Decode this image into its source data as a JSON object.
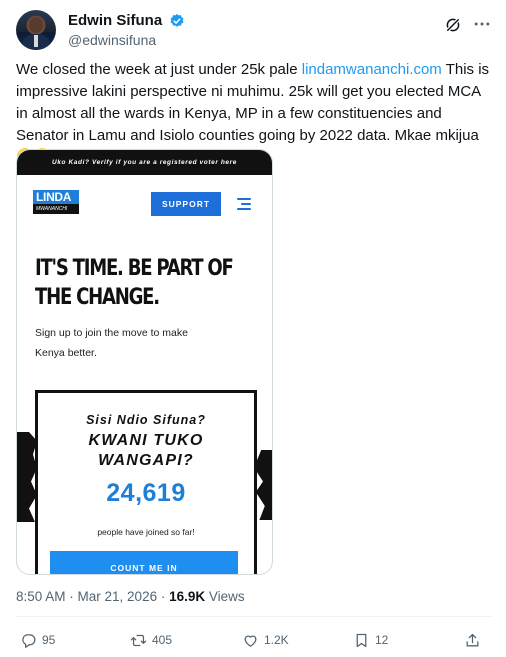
{
  "author": {
    "display_name": "Edwin Sifuna",
    "handle": "@edwinsifuna"
  },
  "tweet": {
    "text_before_link": "We closed the week at just under 25k pale ",
    "link_text": "lindamwananchi.com",
    "text_after_link": " This is impressive lakini perspective ni muhimu. 25k will get you elected MCA in almost all the wards in Kenya, MP in a few constituencies and Senator in Lamu and Isiolo counties going by 2022 data. Mkae mkijua"
  },
  "media": {
    "promo_bar": "Uko Kadi? Verify if you are a registered voter here",
    "logo_top": "LINDA",
    "logo_bottom": "MWANANCHI",
    "support_button": "SUPPORT",
    "headline_line1": "IT'S TIME. BE PART OF",
    "headline_line2": "THE CHANGE.",
    "subline_line1": "Sign up to join the move to make",
    "subline_line2": "Kenya better.",
    "card_line1": "Sisi Ndio Sifuna?",
    "card_line2": "KWANI TUKO",
    "card_line3": "WANGAPI?",
    "count": "24,619",
    "joined_text": "people have joined so far!",
    "count_me_button": "COUNT ME IN"
  },
  "meta": {
    "time": "8:50 AM",
    "separator1": " · ",
    "date": "Mar 21, 2026",
    "separator2": " · ",
    "views_count": "16.9K",
    "views_label": " Views"
  },
  "actions": {
    "replies": "95",
    "reposts": "405",
    "likes": "1.2K",
    "bookmarks": "12"
  },
  "colors": {
    "link": "#1d9bf0",
    "verified": "#1d9bf0",
    "muted_text": "#536471",
    "brand_blue": "#1e6fd9"
  },
  "icons": [
    "verified-badge-icon",
    "grok-icon",
    "more-icon",
    "reply-icon",
    "repost-icon",
    "like-icon",
    "bookmark-icon",
    "share-icon"
  ]
}
